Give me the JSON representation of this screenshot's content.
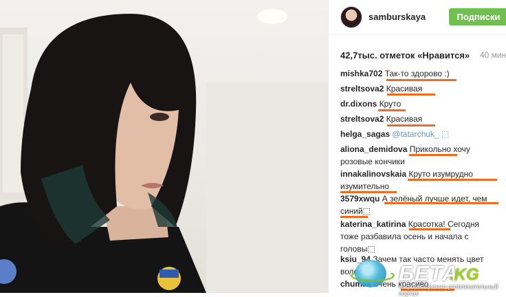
{
  "post": {
    "username": "samburskaya",
    "follow_label": "Подписки",
    "likes": "42,7тыс. отметок «Нравится»",
    "time": "40 мин"
  },
  "comments": [
    {
      "user": "mishka702",
      "text": "Так-то здорово :)"
    },
    {
      "user": "streltsova2",
      "text": "Красивая"
    },
    {
      "user": "dr.dixons",
      "text": "Круто"
    },
    {
      "user": "streltsova2",
      "text": "Красивая"
    },
    {
      "user": "helga_sagas",
      "text": "@tatarchuk_ ⬚"
    },
    {
      "user": "aliona_demidova",
      "text": "Прикольно хочу",
      "line2": "розовые кончики"
    },
    {
      "user": "innakalinovskaia",
      "text": "Круто изумрудно",
      "line2": "изумительно"
    },
    {
      "user": "3579xwqu",
      "text": "А зелёный лучше идет, чем",
      "line2": "синий⬚"
    },
    {
      "user": "katerina_katirina",
      "text": "Красотка! Сегодня",
      "line2": "тоже разбавила осень и начала с",
      "line3": "головы⬚"
    },
    {
      "user": "ksiu_94",
      "text": "Зачем так часто менять цвет",
      "line2": "волос"
    },
    {
      "user": "chumak",
      "text": "очень красиво"
    }
  ],
  "watermark": {
    "brand": "БЕТА",
    "domain": ".KG",
    "tagline": "информационно-развлекательный портал"
  },
  "icons": {
    "avatar": "profile-avatar",
    "globe": "globe-logo-icon"
  },
  "colors": {
    "follow": "#70c050",
    "highlight": "#f26a1b"
  }
}
